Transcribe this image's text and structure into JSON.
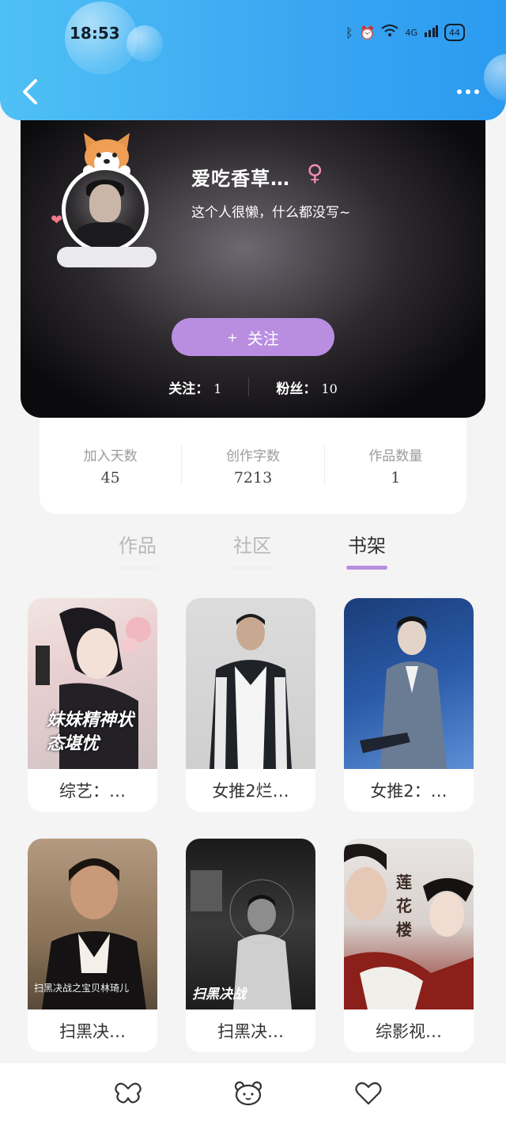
{
  "status_bar": {
    "time": "18:53",
    "network": "4G",
    "battery": "44"
  },
  "profile": {
    "name": "爱吃香草…",
    "gender_symbol": "♀",
    "bio": "这个人很懒，什么都没写~",
    "follow_button": "关注",
    "follow_plus": "+",
    "following_label": "关注：",
    "following_value": "1",
    "fans_label": "粉丝：",
    "fans_value": "10"
  },
  "stats": [
    {
      "label": "加入天数",
      "value": "45"
    },
    {
      "label": "创作字数",
      "value": "7213"
    },
    {
      "label": "作品数量",
      "value": "1"
    }
  ],
  "tabs": [
    {
      "label": "作品",
      "active": false
    },
    {
      "label": "社区",
      "active": false
    },
    {
      "label": "书架",
      "active": true
    }
  ],
  "books": [
    {
      "title": "综艺：…",
      "cover_text": "妹妹精神状态堪忧"
    },
    {
      "title": "女推2烂…",
      "cover_text": ""
    },
    {
      "title": "女推2：…",
      "cover_text": ""
    },
    {
      "title": "扫黑决…",
      "cover_text": "扫黑决战之宝贝林琦儿"
    },
    {
      "title": "扫黑决…",
      "cover_text": "扫黑决战"
    },
    {
      "title": "综影视…",
      "cover_text": "莲花楼"
    }
  ],
  "colors": {
    "header": "#3aa6f2",
    "accent": "#b98ee1",
    "card_dark": "#0b0a0c"
  }
}
